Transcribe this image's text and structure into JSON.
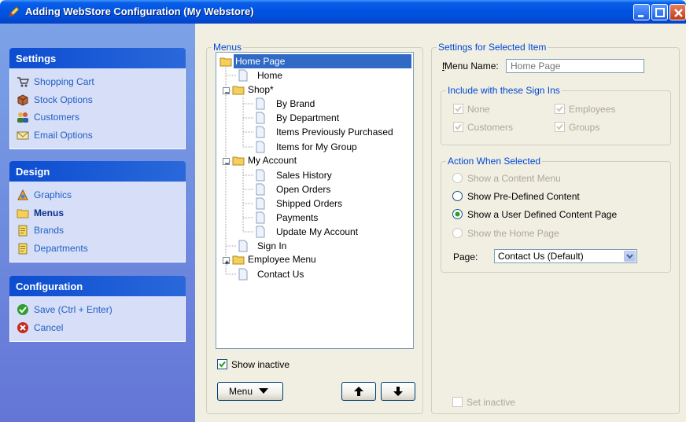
{
  "window": {
    "title": "Adding WebStore Configuration  (My Webstore)"
  },
  "sidebar": {
    "settings": {
      "header": "Settings",
      "items": [
        "Shopping Cart",
        "Stock Options",
        "Customers",
        "Email Options"
      ]
    },
    "design": {
      "header": "Design",
      "items": [
        "Graphics",
        "Menus",
        "Brands",
        "Departments"
      ]
    },
    "configuration": {
      "header": "Configuration",
      "items": [
        "Save (Ctrl + Enter)",
        "Cancel"
      ]
    }
  },
  "menus": {
    "legend": "Menus",
    "tree": [
      "Home Page",
      "Home",
      "Shop*",
      "By Brand",
      "By Department",
      "Items Previously Purchased",
      "Items for My Group",
      "My Account",
      "Sales History",
      "Open Orders",
      "Shipped Orders",
      "Payments",
      "Update My Account",
      "Sign In",
      "Employee Menu",
      "Contact Us"
    ],
    "show_inactive_label": "Show inactive",
    "menu_button": "Menu"
  },
  "settings_panel": {
    "legend": "Settings for Selected Item",
    "menu_name_label": "Menu Name:",
    "menu_name_placeholder": "Home Page",
    "signins_legend": "Include with these Sign Ins",
    "signins": [
      "None",
      "Employees",
      "Customers",
      "Groups"
    ],
    "action_legend": "Action When Selected",
    "actions": [
      "Show a Content Menu",
      "Show Pre-Defined Content",
      "Show a User Defined Content Page",
      "Show the Home Page"
    ],
    "page_label": "Page:",
    "page_value": "Contact Us (Default)",
    "set_inactive_label": "Set inactive"
  },
  "colors": {
    "titlebar": "#0054e3",
    "selection": "#316ac5",
    "legend_text": "#0046d5",
    "task_link": "#215dc6"
  }
}
